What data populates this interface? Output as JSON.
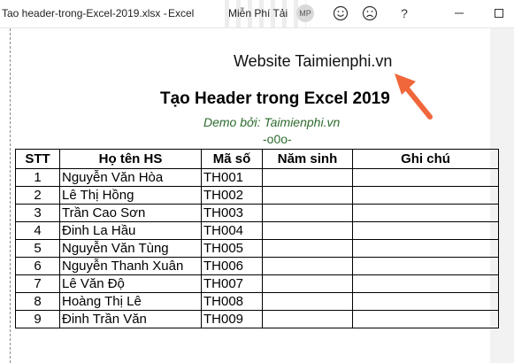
{
  "window": {
    "title": "Tao header-trong-Excel-2019.xlsx",
    "separator": "-",
    "app_name": "Excel",
    "user_name": "Miễn Phí Tải",
    "user_initials": "MP"
  },
  "page": {
    "header_text": "Website Taimienphi.vn",
    "title": "Tạo Header trong Excel 2019",
    "demo_by": "Demo bởi: Taimienphi.vn",
    "divider": "-o0o-"
  },
  "table": {
    "headers": [
      "STT",
      "Họ tên HS",
      "Mã số",
      "Năm sinh",
      "Ghi chú"
    ],
    "rows": [
      {
        "stt": "1",
        "name": "Nguyễn Văn Hòa",
        "code": "TH001"
      },
      {
        "stt": "2",
        "name": "Lê Thị Hồng",
        "code": "TH002"
      },
      {
        "stt": "3",
        "name": "Trần Cao Sơn",
        "code": "TH003"
      },
      {
        "stt": "4",
        "name": "Đinh La Hầu",
        "code": "TH004"
      },
      {
        "stt": "5",
        "name": "Nguyễn Văn Tùng",
        "code": "TH005"
      },
      {
        "stt": "6",
        "name": "Nguyễn Thanh Xuân",
        "code": "TH006"
      },
      {
        "stt": "7",
        "name": "Lê Văn Độ",
        "code": "TH007"
      },
      {
        "stt": "8",
        "name": "Hoàng Thị Lê",
        "code": "TH008"
      },
      {
        "stt": "9",
        "name": "Đinh Trần Văn",
        "code": "TH009"
      }
    ]
  },
  "colors": {
    "arrow": "#f0673b",
    "subtitle_green": "#2e6b2e"
  },
  "icons": [
    "smiley-icon",
    "frown-icon",
    "help-icon",
    "minimize-icon",
    "maximize-icon"
  ]
}
